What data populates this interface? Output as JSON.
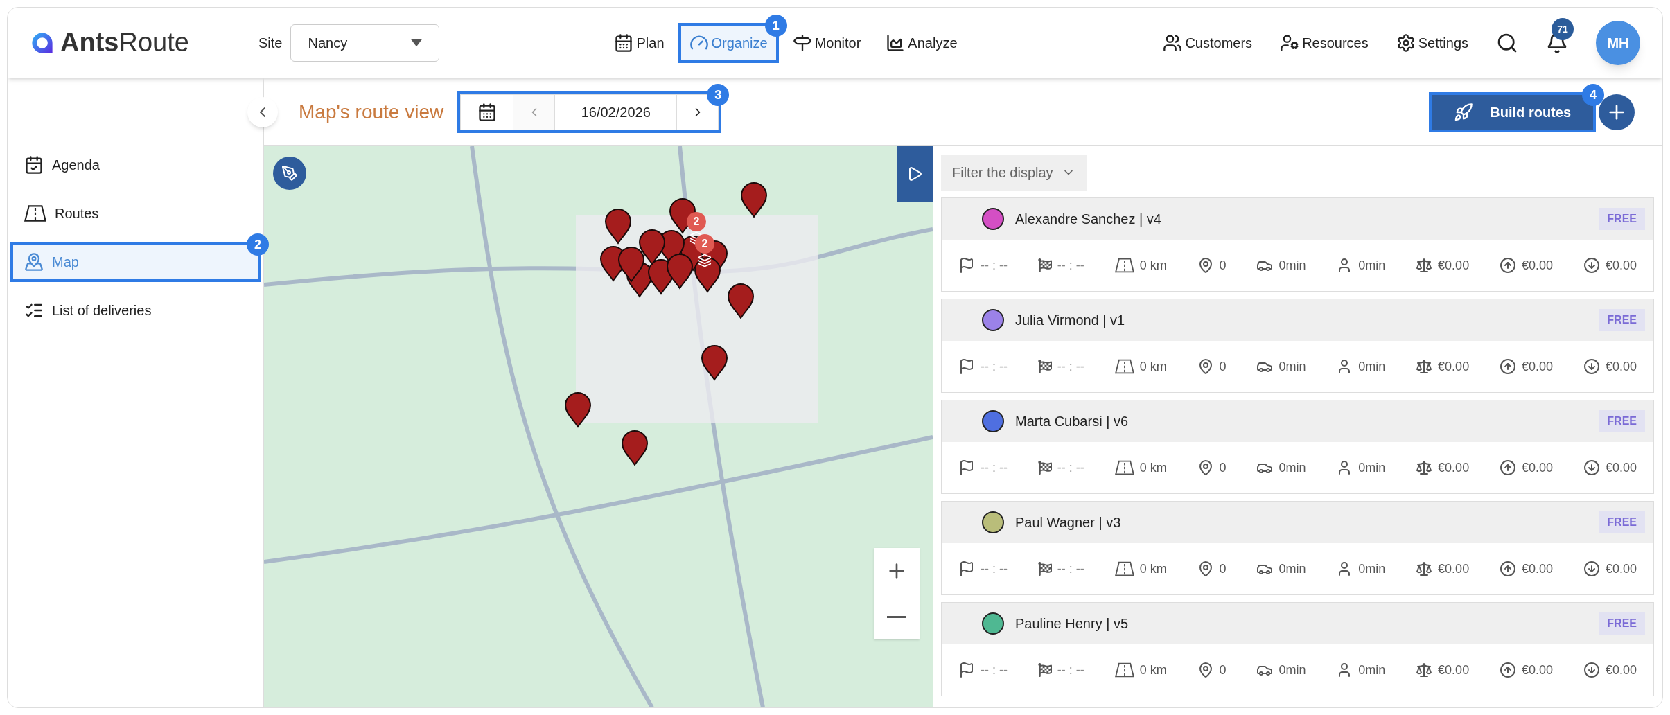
{
  "header": {
    "logo": "**Ants**Route",
    "site_label": "Site",
    "site_value": "Nancy",
    "nav": [
      {
        "kind": "plan",
        "label": "Plan",
        "selected": false
      },
      {
        "kind": "organize",
        "label": "Organize",
        "selected": true,
        "callout": "1"
      },
      {
        "kind": "monitor",
        "label": "Monitor",
        "selected": false
      },
      {
        "kind": "analyze",
        "label": "Analyze",
        "selected": false
      }
    ],
    "tools": [
      {
        "kind": "customers",
        "label": "Customers"
      },
      {
        "kind": "resources",
        "label": "Resources"
      },
      {
        "kind": "settings",
        "label": "Settings"
      }
    ],
    "notifications": "71",
    "avatar": "MH"
  },
  "sidebar": {
    "items": [
      {
        "kind": "agenda",
        "label": "Agenda",
        "selected": false
      },
      {
        "kind": "routes",
        "label": "Routes",
        "selected": false
      },
      {
        "kind": "map",
        "label": "Map",
        "selected": true,
        "callout": "2"
      },
      {
        "kind": "list",
        "label": "List of deliveries",
        "selected": false
      }
    ]
  },
  "toolbar": {
    "title": "Map's route view",
    "date": "16/02/2026",
    "date_callout": "3",
    "build_button": "Build routes",
    "build_callout": "4"
  },
  "map": {
    "clusters": [
      "2",
      "2"
    ]
  },
  "filter": {
    "label": "Filter the display"
  },
  "routes": [
    {
      "name": "Alexandre Sanchez | v4",
      "color": "#d44fc4",
      "badge": "FREE",
      "stats": [
        {
          "kind": "start",
          "value": "-- : --"
        },
        {
          "kind": "end",
          "value": "-- : --"
        },
        {
          "kind": "distance",
          "value": "0 km"
        },
        {
          "kind": "stops",
          "value": "0"
        },
        {
          "kind": "drive",
          "value": "0min"
        },
        {
          "kind": "work",
          "value": "0min"
        },
        {
          "kind": "cost",
          "value": "€0.00"
        },
        {
          "kind": "income",
          "value": "€0.00"
        },
        {
          "kind": "expense",
          "value": "€0.00"
        }
      ]
    },
    {
      "name": "Julia Virmond | v1",
      "color": "#9b82e8",
      "badge": "FREE",
      "stats": [
        {
          "kind": "start",
          "value": "-- : --"
        },
        {
          "kind": "end",
          "value": "-- : --"
        },
        {
          "kind": "distance",
          "value": "0 km"
        },
        {
          "kind": "stops",
          "value": "0"
        },
        {
          "kind": "drive",
          "value": "0min"
        },
        {
          "kind": "work",
          "value": "0min"
        },
        {
          "kind": "cost",
          "value": "€0.00"
        },
        {
          "kind": "income",
          "value": "€0.00"
        },
        {
          "kind": "expense",
          "value": "€0.00"
        }
      ]
    },
    {
      "name": "Marta Cubarsi | v6",
      "color": "#4f6fe0",
      "badge": "FREE",
      "stats": [
        {
          "kind": "start",
          "value": "-- : --"
        },
        {
          "kind": "end",
          "value": "-- : --"
        },
        {
          "kind": "distance",
          "value": "0 km"
        },
        {
          "kind": "stops",
          "value": "0"
        },
        {
          "kind": "drive",
          "value": "0min"
        },
        {
          "kind": "work",
          "value": "0min"
        },
        {
          "kind": "cost",
          "value": "€0.00"
        },
        {
          "kind": "income",
          "value": "€0.00"
        },
        {
          "kind": "expense",
          "value": "€0.00"
        }
      ]
    },
    {
      "name": "Paul Wagner | v3",
      "color": "#b9bd7a",
      "badge": "FREE",
      "stats": [
        {
          "kind": "start",
          "value": "-- : --"
        },
        {
          "kind": "end",
          "value": "-- : --"
        },
        {
          "kind": "distance",
          "value": "0 km"
        },
        {
          "kind": "stops",
          "value": "0"
        },
        {
          "kind": "drive",
          "value": "0min"
        },
        {
          "kind": "work",
          "value": "0min"
        },
        {
          "kind": "cost",
          "value": "€0.00"
        },
        {
          "kind": "income",
          "value": "€0.00"
        },
        {
          "kind": "expense",
          "value": "€0.00"
        }
      ]
    },
    {
      "name": "Pauline Henry | v5",
      "color": "#4fb892",
      "badge": "FREE",
      "stats": [
        {
          "kind": "start",
          "value": "-- : --"
        },
        {
          "kind": "end",
          "value": "-- : --"
        },
        {
          "kind": "distance",
          "value": "0 km"
        },
        {
          "kind": "stops",
          "value": "0"
        },
        {
          "kind": "drive",
          "value": "0min"
        },
        {
          "kind": "work",
          "value": "0min"
        },
        {
          "kind": "cost",
          "value": "€0.00"
        },
        {
          "kind": "income",
          "value": "€0.00"
        },
        {
          "kind": "expense",
          "value": "€0.00"
        }
      ]
    }
  ]
}
